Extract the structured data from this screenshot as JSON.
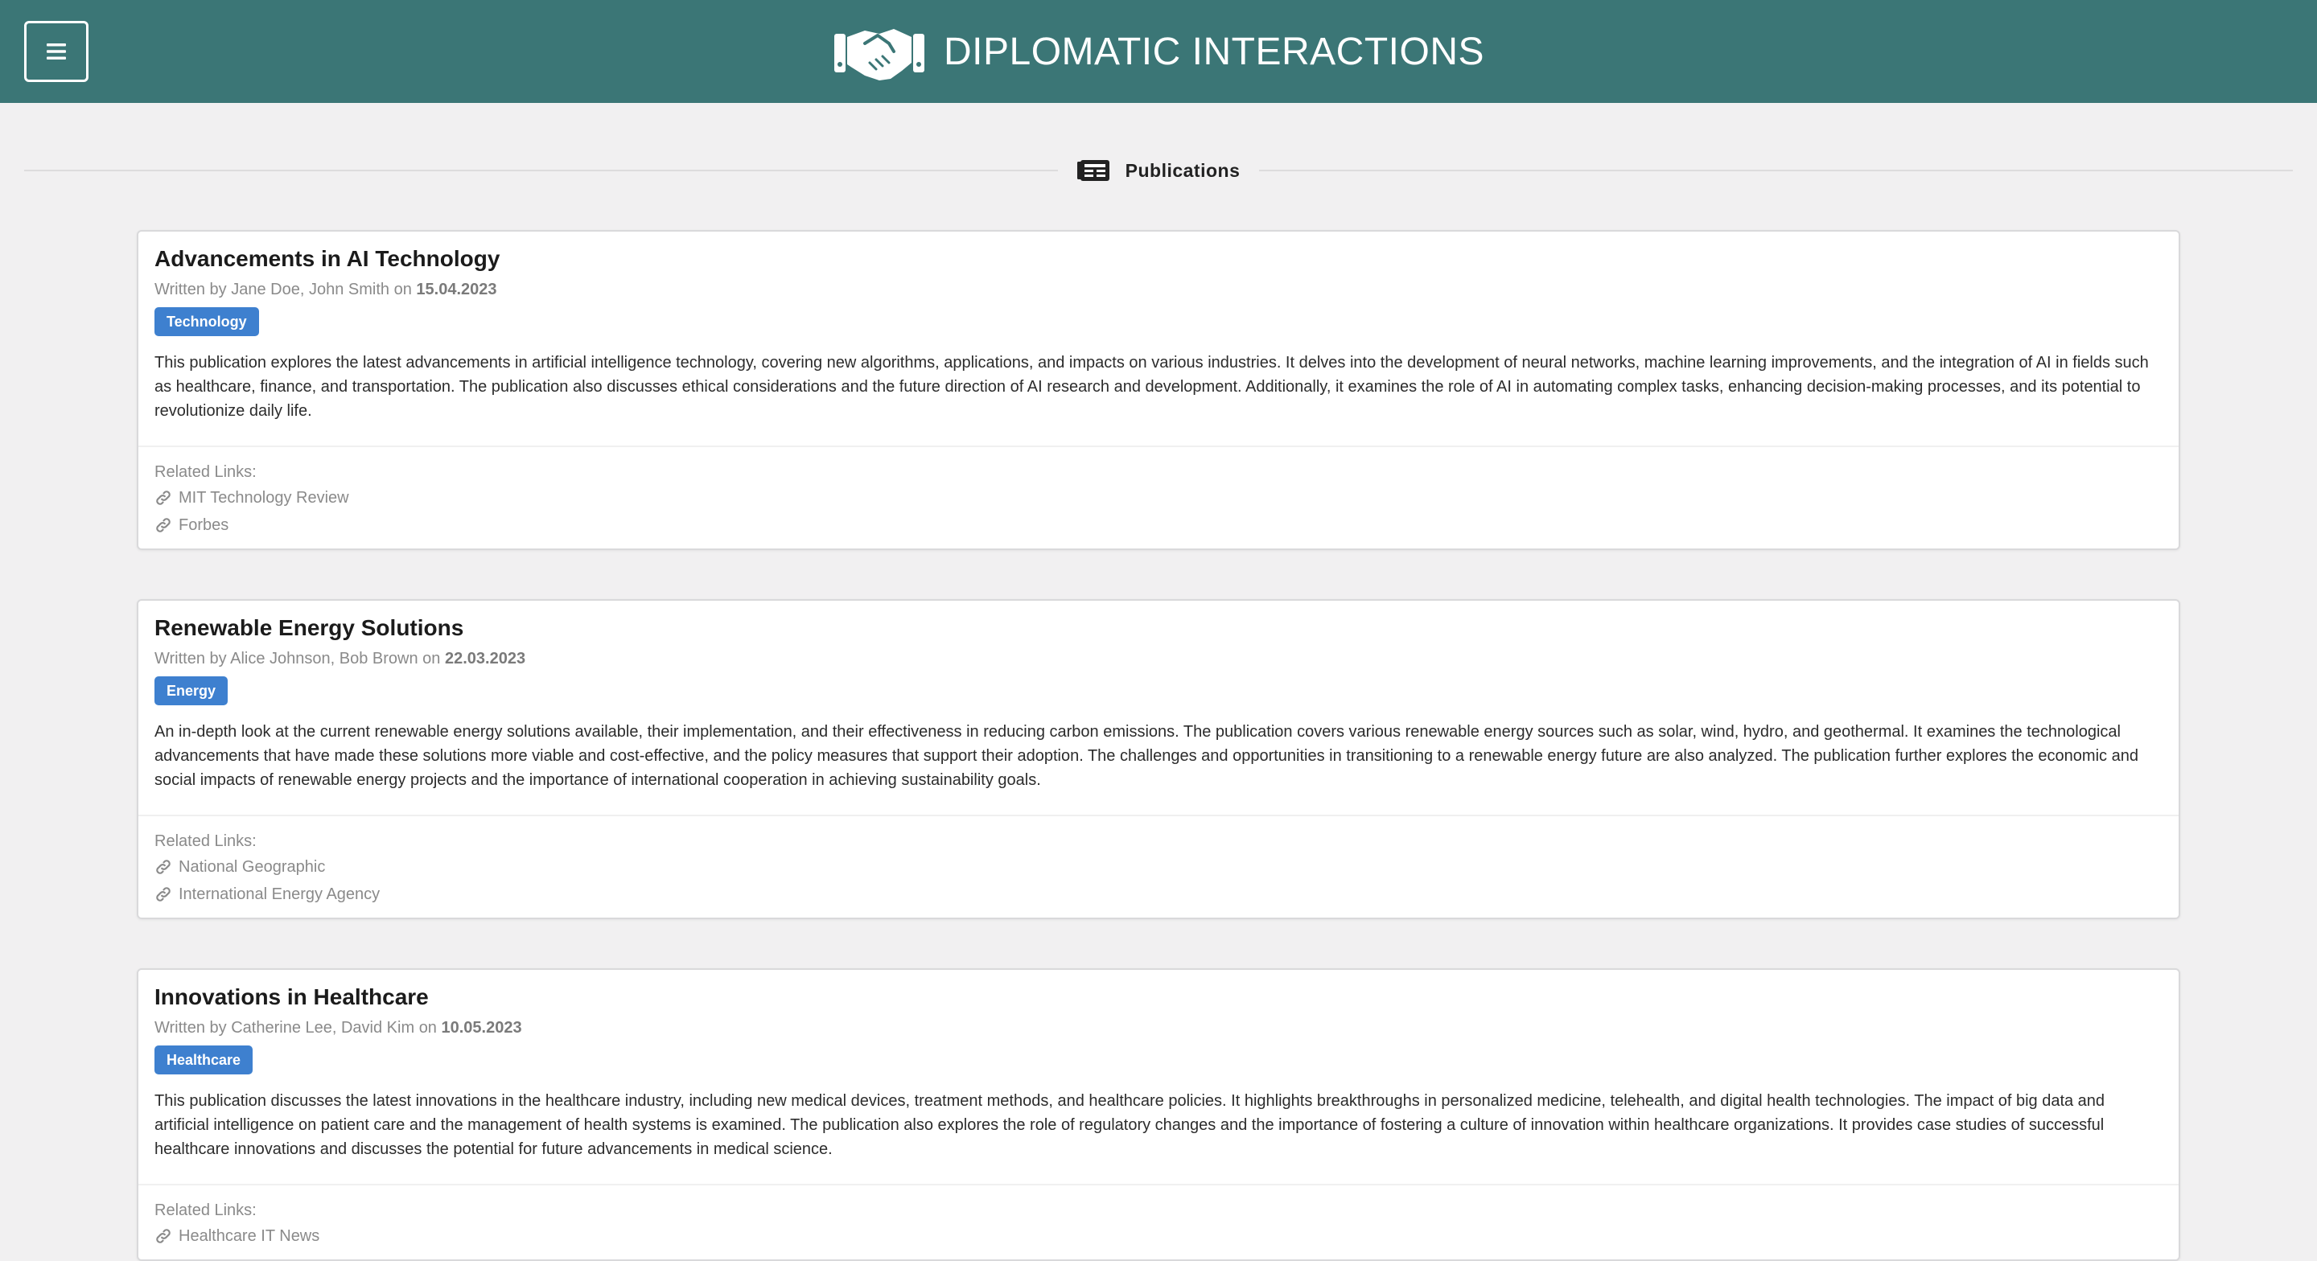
{
  "header": {
    "title": "DIPLOMATIC INTERACTIONS",
    "menu_icon": "hamburger-icon",
    "logo_icon": "handshake-icon",
    "background_color": "#3b7676"
  },
  "section": {
    "label": "Publications",
    "icon": "newspaper-icon"
  },
  "publications": [
    {
      "title": "Advancements in AI Technology",
      "written_by_prefix": "Written by",
      "authors": "Jane Doe, John Smith",
      "on_word": "on",
      "date": "15.04.2023",
      "tag": "Technology",
      "description": "This publication explores the latest advancements in artificial intelligence technology, covering new algorithms, applications, and impacts on various industries. It delves into the development of neural networks, machine learning improvements, and the integration of AI in fields such as healthcare, finance, and transportation. The publication also discusses ethical considerations and the future direction of AI research and development. Additionally, it examines the role of AI in automating complex tasks, enhancing decision-making processes, and its potential to revolutionize daily life.",
      "related_label": "Related Links:",
      "links": [
        "MIT Technology Review",
        "Forbes"
      ]
    },
    {
      "title": "Renewable Energy Solutions",
      "written_by_prefix": "Written by",
      "authors": "Alice Johnson, Bob Brown",
      "on_word": "on",
      "date": "22.03.2023",
      "tag": "Energy",
      "description": "An in-depth look at the current renewable energy solutions available, their implementation, and their effectiveness in reducing carbon emissions. The publication covers various renewable energy sources such as solar, wind, hydro, and geothermal. It examines the technological advancements that have made these solutions more viable and cost-effective, and the policy measures that support their adoption. The challenges and opportunities in transitioning to a renewable energy future are also analyzed. The publication further explores the economic and social impacts of renewable energy projects and the importance of international cooperation in achieving sustainability goals.",
      "related_label": "Related Links:",
      "links": [
        "National Geographic",
        "International Energy Agency"
      ]
    },
    {
      "title": "Innovations in Healthcare",
      "written_by_prefix": "Written by",
      "authors": "Catherine Lee, David Kim",
      "on_word": "on",
      "date": "10.05.2023",
      "tag": "Healthcare",
      "description": "This publication discusses the latest innovations in the healthcare industry, including new medical devices, treatment methods, and healthcare policies. It highlights breakthroughs in personalized medicine, telehealth, and digital health technologies. The impact of big data and artificial intelligence on patient care and the management of health systems is examined. The publication also explores the role of regulatory changes and the importance of fostering a culture of innovation within healthcare organizations. It provides case studies of successful healthcare innovations and discusses the potential for future advancements in medical science.",
      "related_label": "Related Links:",
      "links": [
        "Healthcare IT News"
      ]
    }
  ],
  "colors": {
    "tag": "#3e80cf",
    "page_background": "#f1f0f1"
  }
}
